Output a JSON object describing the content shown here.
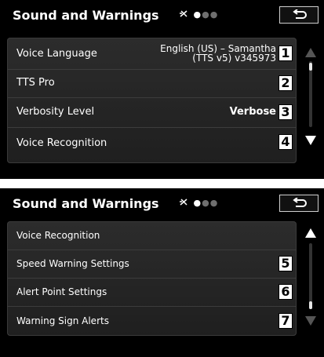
{
  "screen1": {
    "title": "Sound and Warnings",
    "rows": [
      {
        "label": "Voice Language",
        "value_line1": "English (US) – Samantha",
        "value_line2": "(TTS v5) v345973",
        "callout": "1"
      },
      {
        "label": "TTS Pro",
        "callout": "2"
      },
      {
        "label": "Verbosity Level",
        "value": "Verbose",
        "callout": "3"
      },
      {
        "label": "Voice Recognition",
        "callout": "4"
      }
    ]
  },
  "screen2": {
    "title": "Sound and Warnings",
    "rows": [
      {
        "label": "Voice Recognition"
      },
      {
        "label": "Speed Warning Settings",
        "callout": "5"
      },
      {
        "label": "Alert Point Settings",
        "callout": "6"
      },
      {
        "label": "Warning Sign Alerts",
        "callout": "7"
      }
    ]
  },
  "colors": {
    "background": "#000000",
    "text": "#ffffff",
    "row_border": "#3c3c3c",
    "callout_bg": "#ffffff"
  },
  "icons": [
    "gps-signal-icon",
    "back-arrow-icon",
    "scroll-up-icon",
    "scroll-down-icon"
  ]
}
